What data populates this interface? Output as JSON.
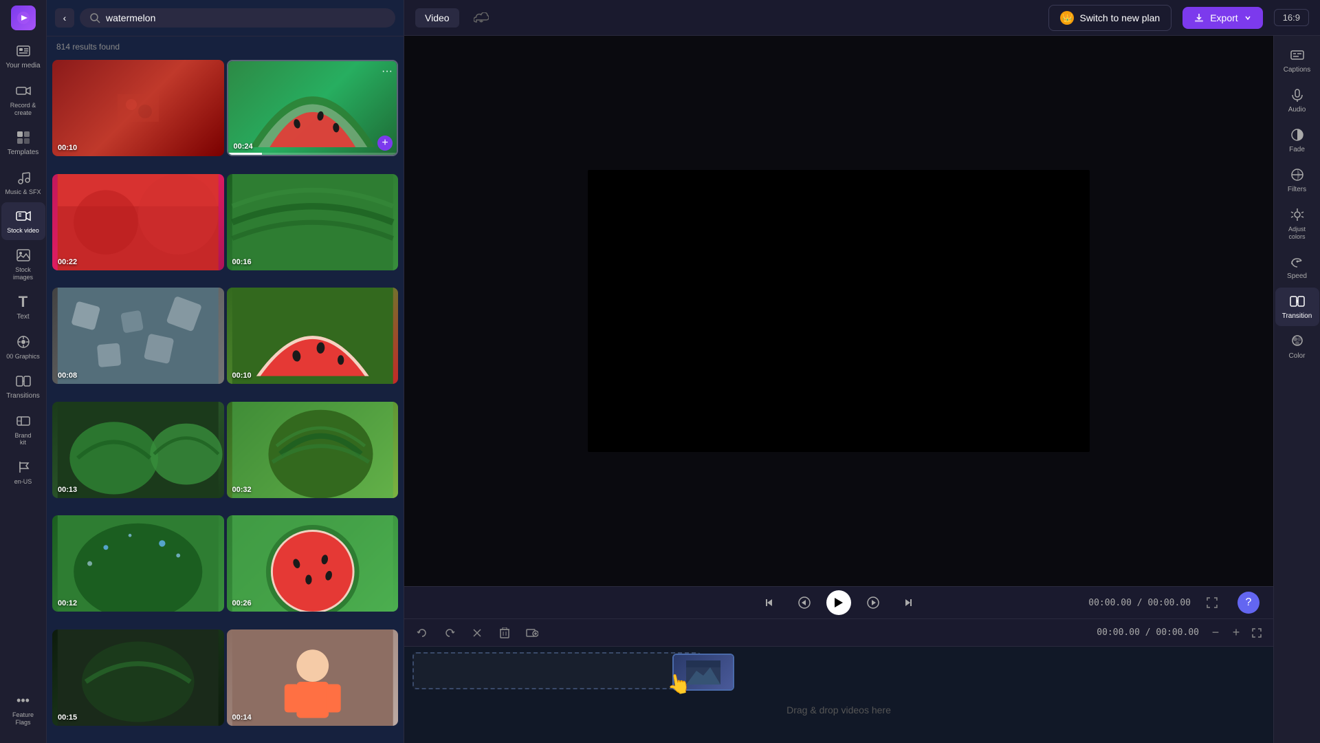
{
  "app": {
    "logo_emoji": "🎬"
  },
  "left_sidebar": {
    "items": [
      {
        "id": "your-media",
        "label": "Your media",
        "icon": "🖼️",
        "active": false
      },
      {
        "id": "record-create",
        "label": "Record &\ncreate",
        "icon": "📹",
        "active": false
      },
      {
        "id": "templates",
        "label": "Templates",
        "icon": "⊞",
        "active": false
      },
      {
        "id": "music-sfx",
        "label": "Music & SFX",
        "icon": "🎵",
        "active": false
      },
      {
        "id": "stock-video",
        "label": "Stock video",
        "icon": "🎞️",
        "active": true
      },
      {
        "id": "stock-images",
        "label": "Stock\nimages",
        "icon": "🏔️",
        "active": false
      },
      {
        "id": "text",
        "label": "Text",
        "icon": "T",
        "active": false
      },
      {
        "id": "graphics",
        "label": "00 Graphics",
        "icon": "🔷",
        "active": false
      },
      {
        "id": "transitions",
        "label": "Transitions",
        "icon": "⇄",
        "active": false
      },
      {
        "id": "brand-kit",
        "label": "Brand kit",
        "icon": "💼",
        "active": false
      },
      {
        "id": "feature-flags",
        "label": "Feature Flags",
        "icon": "⚑",
        "active": false
      }
    ]
  },
  "search_panel": {
    "back_label": "‹",
    "search_placeholder": "watermelon",
    "search_value": "watermelon",
    "results_count": "814 results found",
    "videos": [
      {
        "id": 1,
        "duration": "00:10",
        "color": "red-texture",
        "has_scrub": false,
        "scrub_pct": 0
      },
      {
        "id": 2,
        "duration": "00:24",
        "color": "green-watermelon",
        "has_scrub": true,
        "scrub_pct": 20,
        "has_more": true,
        "has_add": true
      },
      {
        "id": 3,
        "duration": "00:22",
        "color": "pink-slice",
        "has_scrub": false,
        "scrub_pct": 0
      },
      {
        "id": 4,
        "duration": "00:16",
        "color": "green-slice",
        "has_scrub": false,
        "scrub_pct": 0
      },
      {
        "id": 5,
        "duration": "00:08",
        "color": "gray",
        "has_scrub": false,
        "scrub_pct": 0
      },
      {
        "id": 6,
        "duration": "00:10",
        "color": "red-half",
        "has_scrub": false,
        "scrub_pct": 0
      },
      {
        "id": 7,
        "duration": "00:13",
        "color": "dark-green",
        "has_scrub": false,
        "scrub_pct": 0
      },
      {
        "id": 8,
        "duration": "00:32",
        "color": "round-wm",
        "has_scrub": false,
        "scrub_pct": 0
      },
      {
        "id": 9,
        "duration": "00:12",
        "color": "wm-drops",
        "has_scrub": false,
        "scrub_pct": 0
      },
      {
        "id": 10,
        "duration": "00:26",
        "color": "pink-circle",
        "has_scrub": false,
        "scrub_pct": 0
      },
      {
        "id": 11,
        "duration": "00:15",
        "color": "dark-wm",
        "has_scrub": false,
        "scrub_pct": 0
      },
      {
        "id": 12,
        "duration": "00:14",
        "color": "child",
        "has_scrub": false,
        "scrub_pct": 0
      }
    ]
  },
  "top_bar": {
    "video_tab": "Video",
    "captions_label": "Captions",
    "audio_label": "Audio",
    "fade_label": "Fade",
    "filters_label": "Filters",
    "adjust_colors_label": "Adjust colors",
    "speed_label": "Speed",
    "new_plan_label": "Switch to new plan",
    "export_label": "Export",
    "aspect_ratio": "16:9"
  },
  "right_sidebar": {
    "items": [
      {
        "id": "captions",
        "label": "Captions",
        "icon": "⊡"
      },
      {
        "id": "audio",
        "label": "Audio",
        "icon": "🔊"
      },
      {
        "id": "fade",
        "label": "Fade",
        "icon": "◑"
      },
      {
        "id": "filters",
        "label": "Filters",
        "icon": "✦"
      },
      {
        "id": "adjust-colors",
        "label": "Adjust\ncolors",
        "icon": "🎨"
      },
      {
        "id": "speed",
        "label": "Speed",
        "icon": "⚡"
      },
      {
        "id": "transition",
        "label": "Transition",
        "icon": "⇄",
        "active": true
      },
      {
        "id": "color",
        "label": "Color",
        "icon": "🎨"
      }
    ]
  },
  "playback": {
    "time_current": "00:00",
    "time_frames_current": "00",
    "time_total": "00:00",
    "time_frames_total": "00",
    "time_display": "00:00.00 / 00:00.00"
  },
  "timeline": {
    "drop_hint": "Drag & drop videos here"
  }
}
